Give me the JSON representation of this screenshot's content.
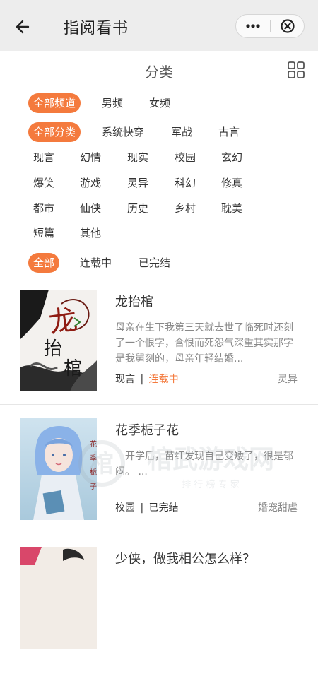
{
  "header": {
    "title": "指阅看书",
    "back_icon": "arrow-left-icon",
    "more_icon": "more-dots-icon",
    "close_icon": "close-circle-icon"
  },
  "section": {
    "title": "分类",
    "layout_icon": "grid-icon"
  },
  "channels": {
    "items": [
      "全部频道",
      "男频",
      "女频"
    ],
    "selected": "全部频道"
  },
  "categories": {
    "items": [
      "全部分类",
      "系统快穿",
      "军战",
      "古言",
      "现言",
      "幻情",
      "现实",
      "校园",
      "玄幻",
      "爆笑",
      "游戏",
      "灵异",
      "科幻",
      "修真",
      "都市",
      "仙侠",
      "历史",
      "乡村",
      "耽美",
      "短篇",
      "其他"
    ],
    "selected": "全部分类"
  },
  "status_filter": {
    "items": [
      "全部",
      "连载中",
      "已完结"
    ],
    "selected": "全部"
  },
  "books": [
    {
      "title": "龙抬棺",
      "description": "母亲在生下我第三天就去世了临死时还刻了一个恨字，含恨而死怨气深重其实那字是我舅刻的，母亲年轻结婚...",
      "category": "现言",
      "status": "连载中",
      "tag": "灵异",
      "cover_text": "龙抬棺"
    },
    {
      "title": "花季栀子花",
      "description": "开学后，苗红发现自己变矮了，很是郁闷。 ...",
      "category": "校园",
      "status": "已完结",
      "tag": "婚宠甜虐"
    },
    {
      "title": "少侠，做我相公怎么样？"
    }
  ],
  "meta_separator": "|",
  "watermark": {
    "main": "棺武游戏网",
    "sub": "排 行 榜 专 家"
  },
  "colors": {
    "accent": "#f47a3d",
    "topbar": "#ededed",
    "muted": "#888888"
  }
}
